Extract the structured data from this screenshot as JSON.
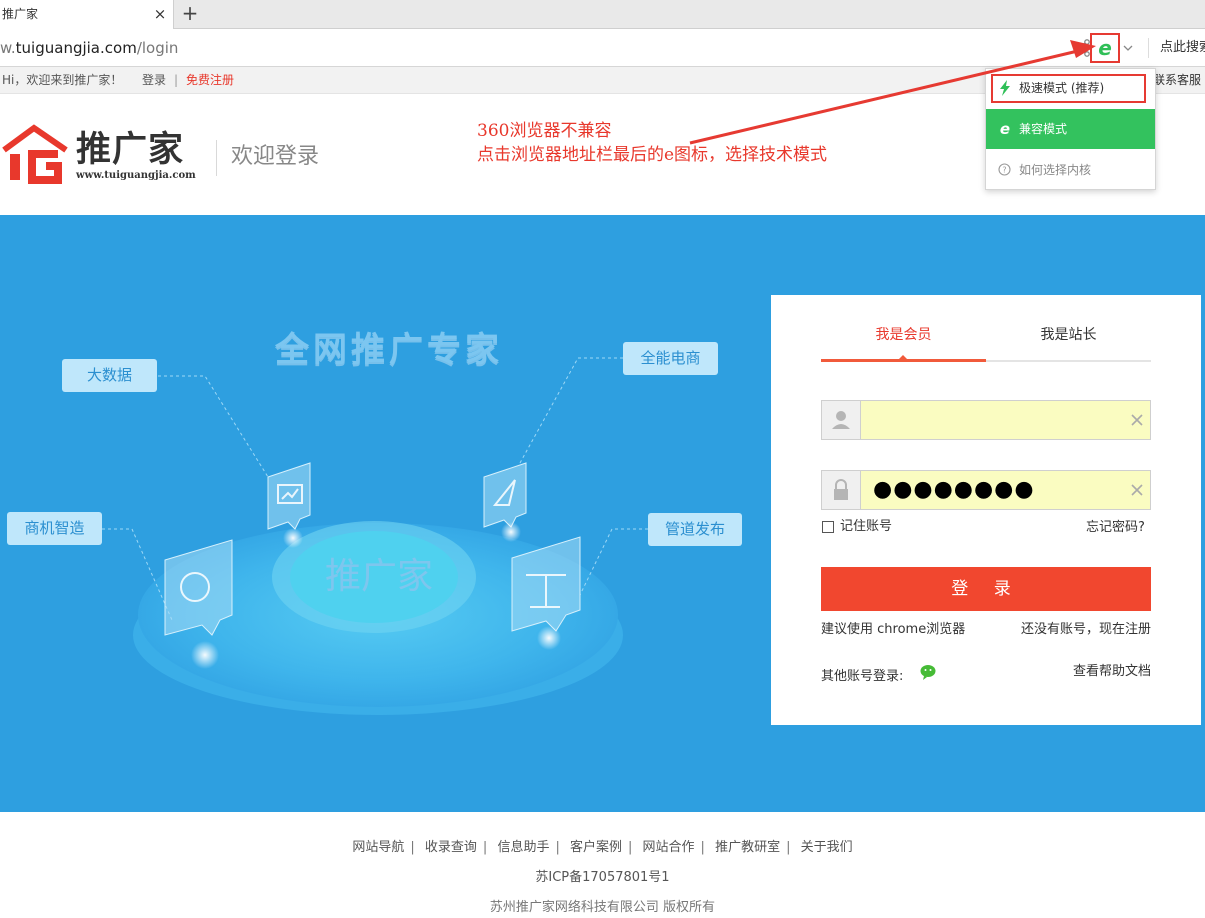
{
  "browser": {
    "tab_title": "推广家",
    "tab_close": "×",
    "new_tab": "+",
    "url_prefix": "w.",
    "url_host": "tuiguangjia.com",
    "url_path": "/login",
    "search_hint": "点此搜索",
    "dropdown": {
      "items": [
        {
          "label": "极速模式 (推荐)",
          "icon": "lightning-icon"
        },
        {
          "label": "兼容模式",
          "icon": "ie-icon"
        },
        {
          "label": "如何选择内核",
          "icon": "question-icon"
        }
      ]
    }
  },
  "topbar": {
    "greeting": "Hi，欢迎来到推广家！",
    "login": "登录",
    "separator": "|",
    "register": "免费注册",
    "customer_service": "联系客服"
  },
  "header": {
    "logo_title": "推广家",
    "logo_url": "www.tuiguangjia.com",
    "welcome": "欢迎登录"
  },
  "annotation": {
    "line1": "360浏览器不兼容",
    "line2": "点击浏览器地址栏最后的e图标，选择技术模式"
  },
  "banner": {
    "slogan": "全网推广专家",
    "center": "推广家",
    "tags": [
      "大数据",
      "全能电商",
      "商机智造",
      "管道发布"
    ]
  },
  "login": {
    "tabs": [
      "我是会员",
      "我是站长"
    ],
    "username_value": "",
    "password_value": "●●●●●●●●",
    "remember": "记住账号",
    "forgot": "忘记密码?",
    "submit": "登 录",
    "tip_chrome": "建议使用 chrome浏览器",
    "signup": "还没有账号，现在注册",
    "other_login": "其他账号登录:",
    "help": "查看帮助文档"
  },
  "footer": {
    "links": [
      "网站导航",
      "收录查询",
      "信息助手",
      "客户案例",
      "网站合作",
      "推广教研室",
      "关于我们"
    ],
    "icp": "苏ICP备17057801号1",
    "copyright": "苏州推广家网络科技有限公司 版权所有"
  },
  "colors": {
    "brand_red": "#e8382c",
    "banner_blue": "#2e9fe0",
    "login_button": "#f1472f",
    "compat_green": "#33c25e"
  }
}
